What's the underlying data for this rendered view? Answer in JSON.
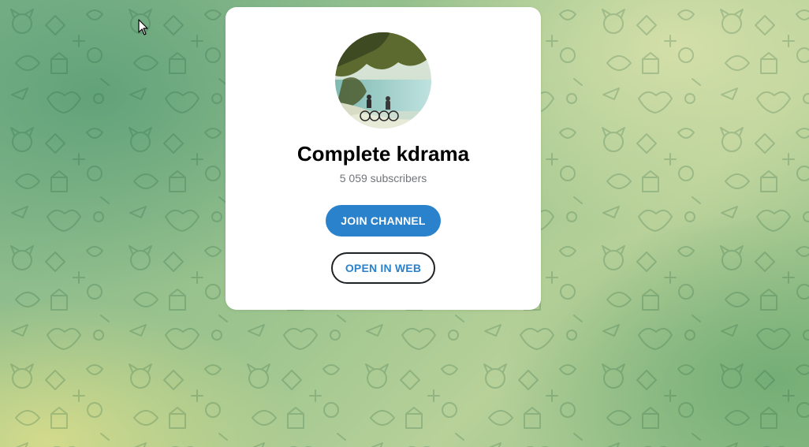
{
  "channel": {
    "title": "Complete kdrama",
    "subscribers": "5 059 subscribers",
    "avatar_icon": "channel-photo"
  },
  "actions": {
    "join_label": "JOIN CHANNEL",
    "open_web_label": "OPEN IN WEB"
  },
  "colors": {
    "accent": "#2b82cc",
    "card": "#ffffff",
    "subtitle": "#707579"
  }
}
